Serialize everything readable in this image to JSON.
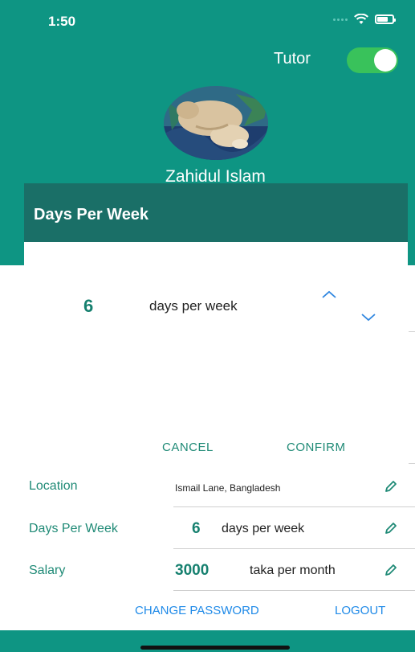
{
  "status_bar": {
    "time": "1:50"
  },
  "header": {
    "tutor_label": "Tutor",
    "tutor_toggle_on": true,
    "profile_name": "Zahidul Islam"
  },
  "dialog": {
    "title": "Days Per Week",
    "picker_value": "6",
    "picker_unit": "days per week",
    "cancel_label": "CANCEL",
    "confirm_label": "CONFIRM"
  },
  "fields": {
    "location": {
      "label": "Location",
      "value": "Ismail Lane, Bangladesh"
    },
    "days_per_week": {
      "label": "Days Per Week",
      "value": "6",
      "unit": "days per week"
    },
    "salary": {
      "label": "Salary",
      "value": "3000",
      "unit": "taka per month"
    }
  },
  "actions": {
    "change_password_label": "CHANGE PASSWORD",
    "logout_label": "LOGOUT"
  },
  "colors": {
    "teal": "#0e9583",
    "dialog_header": "#1a6f67",
    "accent_text": "#1f8a76",
    "link_blue": "#1f8ae8",
    "toggle_green": "#39c25b"
  },
  "icons": {
    "edit": "pencil-icon",
    "up": "chevron-up-icon",
    "down": "chevron-down-icon"
  }
}
